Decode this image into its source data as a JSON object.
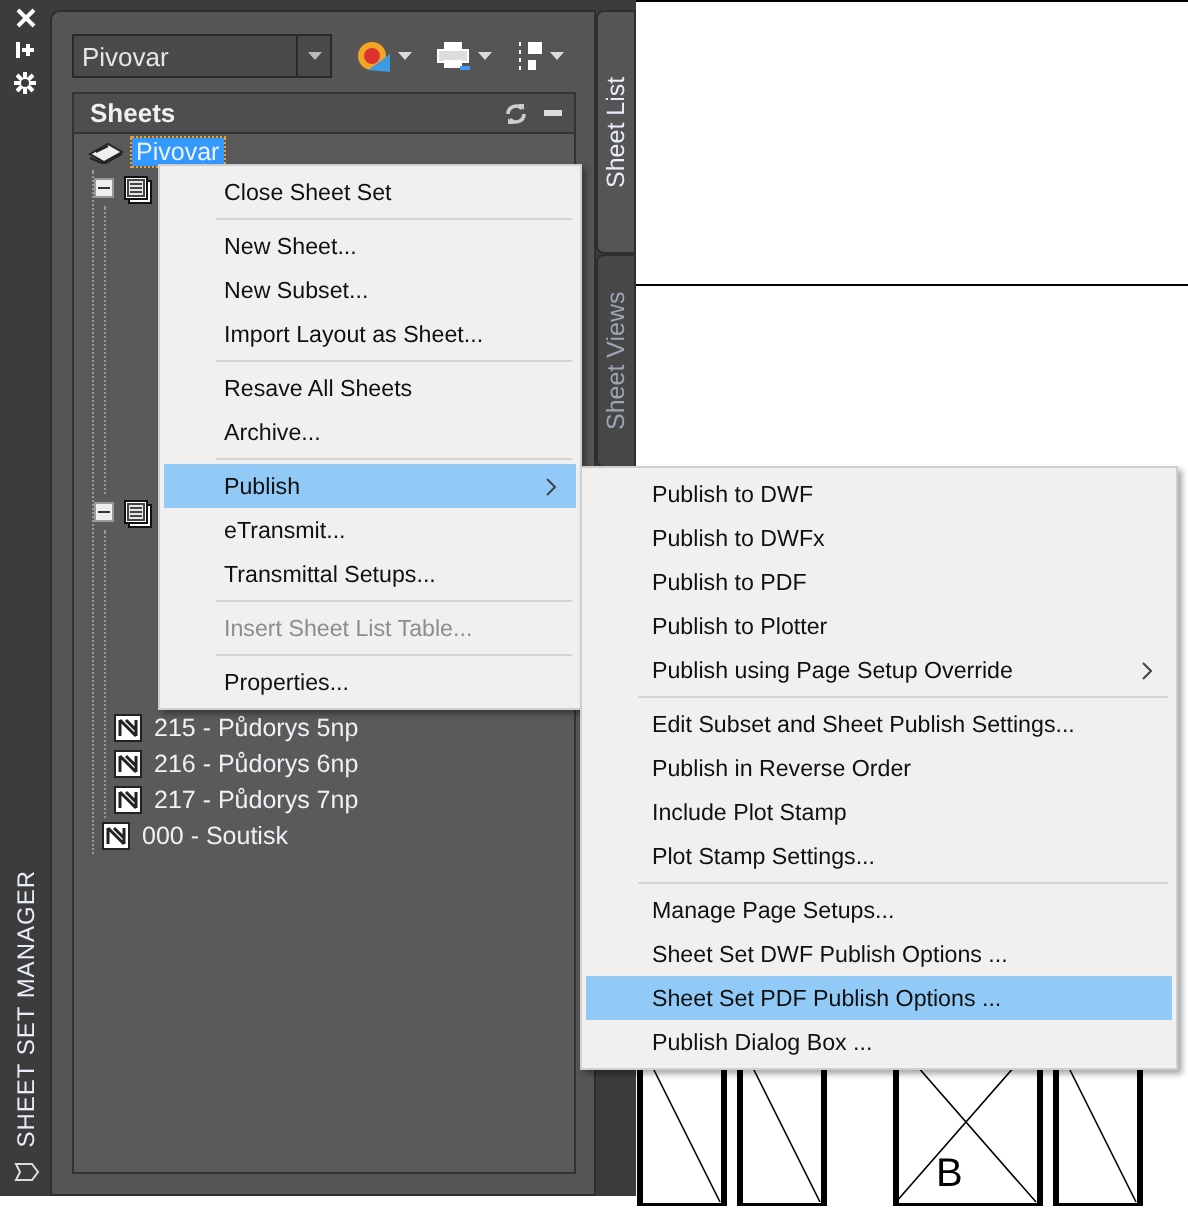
{
  "left_strip": {
    "title": "SHEET SET MANAGER"
  },
  "sheet_set_combo": {
    "value": "Pivovar"
  },
  "sheets_panel": {
    "title": "Sheets",
    "tree": [
      {
        "kind": "sheet_set",
        "label": "Pivovar",
        "selected": true,
        "children": [
          {
            "kind": "subset",
            "expanded": true
          },
          {
            "kind": "subset",
            "expanded": true,
            "children": [
              {
                "kind": "sheet",
                "label": "215 - Půdorys 5np",
                "selected": false
              },
              {
                "kind": "sheet",
                "label": "216 - Půdorys 6np",
                "selected": false
              },
              {
                "kind": "sheet",
                "label": "217 - Půdorys 7np",
                "selected": false
              }
            ]
          },
          {
            "kind": "sheet",
            "label": "000 - Soutisk",
            "selected": false
          }
        ]
      }
    ]
  },
  "side_tabs": [
    {
      "label": "Sheet List",
      "selected": true
    },
    {
      "label": "Sheet Views",
      "selected": false
    }
  ],
  "context_menu": {
    "groups": [
      [
        {
          "label": "Close Sheet Set",
          "selected": false,
          "disabled": false,
          "submenu": false
        }
      ],
      [
        {
          "label": "New Sheet...",
          "selected": false,
          "disabled": false,
          "submenu": false
        },
        {
          "label": "New Subset...",
          "selected": false,
          "disabled": false,
          "submenu": false
        },
        {
          "label": "Import Layout as Sheet...",
          "selected": false,
          "disabled": false,
          "submenu": false
        }
      ],
      [
        {
          "label": "Resave All Sheets",
          "selected": false,
          "disabled": false,
          "submenu": false
        },
        {
          "label": "Archive...",
          "selected": false,
          "disabled": false,
          "submenu": false
        }
      ],
      [
        {
          "label": "Publish",
          "selected": true,
          "disabled": false,
          "submenu": true
        },
        {
          "label": "eTransmit...",
          "selected": false,
          "disabled": false,
          "submenu": false
        },
        {
          "label": "Transmittal Setups...",
          "selected": false,
          "disabled": false,
          "submenu": false
        }
      ],
      [
        {
          "label": "Insert Sheet List Table...",
          "selected": false,
          "disabled": true,
          "submenu": false
        }
      ],
      [
        {
          "label": "Properties...",
          "selected": false,
          "disabled": false,
          "submenu": false
        }
      ]
    ]
  },
  "submenu": {
    "groups": [
      [
        {
          "label": "Publish to DWF",
          "selected": false,
          "disabled": false,
          "submenu": false
        },
        {
          "label": "Publish to DWFx",
          "selected": false,
          "disabled": false,
          "submenu": false
        },
        {
          "label": "Publish to PDF",
          "selected": false,
          "disabled": false,
          "submenu": false
        },
        {
          "label": "Publish to Plotter",
          "selected": false,
          "disabled": false,
          "submenu": false
        },
        {
          "label": "Publish using Page Setup Override",
          "selected": false,
          "disabled": false,
          "submenu": true
        }
      ],
      [
        {
          "label": "Edit Subset and Sheet Publish Settings...",
          "selected": false,
          "disabled": false,
          "submenu": false
        },
        {
          "label": "Publish in Reverse Order",
          "selected": false,
          "disabled": false,
          "submenu": false
        },
        {
          "label": "Include Plot Stamp",
          "selected": false,
          "disabled": false,
          "submenu": false
        },
        {
          "label": "Plot Stamp Settings...",
          "selected": false,
          "disabled": false,
          "submenu": false
        }
      ],
      [
        {
          "label": "Manage Page Setups...",
          "selected": false,
          "disabled": false,
          "submenu": false
        },
        {
          "label": "Sheet Set DWF Publish Options ...",
          "selected": false,
          "disabled": false,
          "submenu": false
        },
        {
          "label": "Sheet Set PDF Publish Options ...",
          "selected": true,
          "disabled": false,
          "submenu": false
        },
        {
          "label": "Publish Dialog Box ...",
          "selected": false,
          "disabled": false,
          "submenu": false
        }
      ]
    ]
  },
  "drawing": {
    "label": "B"
  }
}
